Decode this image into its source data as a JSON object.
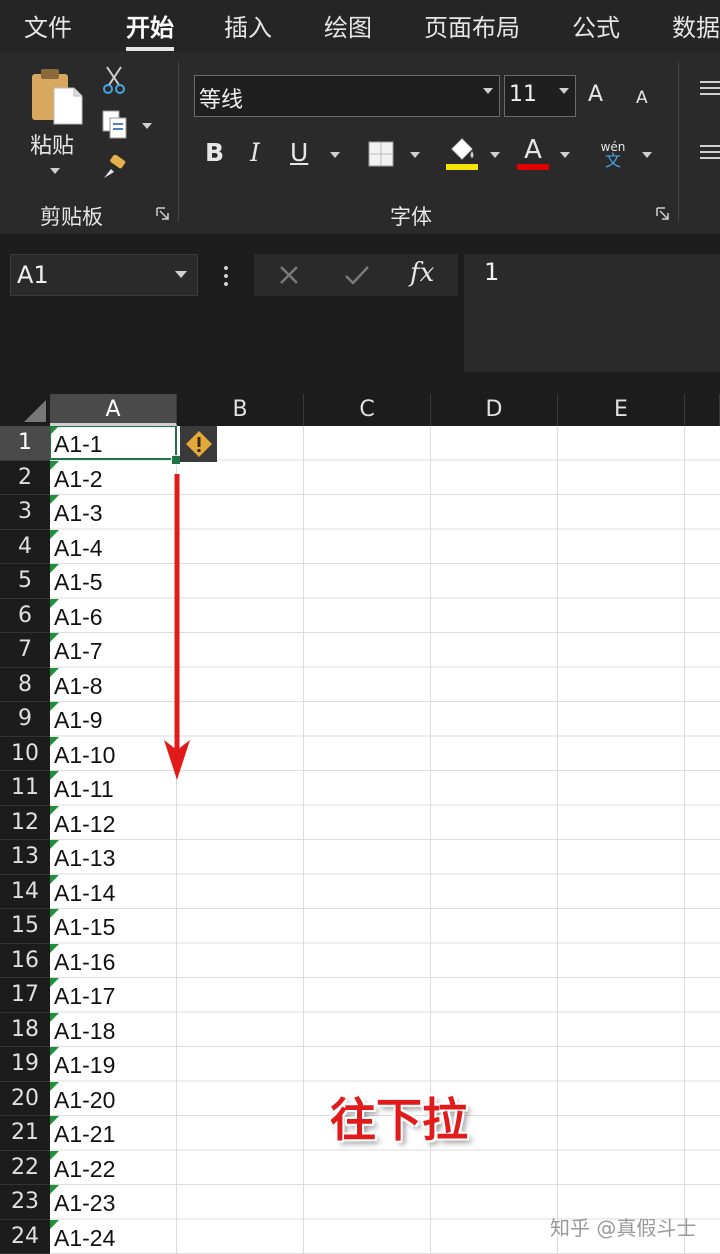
{
  "ribbon": {
    "tabs": [
      "文件",
      "开始",
      "插入",
      "绘图",
      "页面布局",
      "公式",
      "数据"
    ],
    "active_tab": "开始",
    "clipboard": {
      "paste_label": "粘贴",
      "group_label": "剪贴板"
    },
    "font": {
      "name": "等线",
      "size": "11",
      "group_label": "字体",
      "bold": "B",
      "italic": "I",
      "underline": "U",
      "grow": "A",
      "shrink": "A",
      "font_color_glyph": "A",
      "phonetic_top": "wén",
      "phonetic_bottom": "文"
    },
    "colors": {
      "highlight": "#f5e400",
      "font_color": "#e00000"
    }
  },
  "formula_bar": {
    "name_box": "A1",
    "fx": "fx",
    "value": "1"
  },
  "grid": {
    "columns": [
      "A",
      "B",
      "C",
      "D",
      "E"
    ],
    "selected_column": "A",
    "rows": [
      "1",
      "2",
      "3",
      "4",
      "5",
      "6",
      "7",
      "8",
      "9",
      "10",
      "11",
      "12",
      "13",
      "14",
      "15",
      "16",
      "17",
      "18",
      "19",
      "20",
      "21",
      "22",
      "23",
      "24"
    ],
    "column_a": [
      "A1-1",
      "A1-2",
      "A1-3",
      "A1-4",
      "A1-5",
      "A1-6",
      "A1-7",
      "A1-8",
      "A1-9",
      "A1-10",
      "A1-11",
      "A1-12",
      "A1-13",
      "A1-14",
      "A1-15",
      "A1-16",
      "A1-17",
      "A1-18",
      "A1-19",
      "A1-20",
      "A1-21",
      "A1-22",
      "A1-23",
      "A1-24"
    ],
    "active_cell": "A1"
  },
  "annotation": {
    "text": "往下拉",
    "color": "#e11b1b"
  },
  "watermark": "知乎 @真假斗士"
}
